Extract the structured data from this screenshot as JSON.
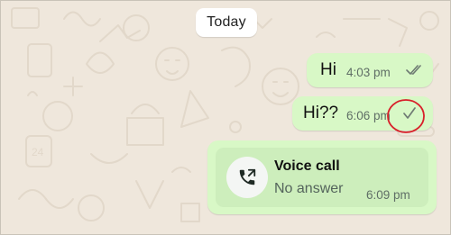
{
  "chat": {
    "date_chip": "Today",
    "messages": [
      {
        "text": "Hi",
        "time": "4:03 pm",
        "status": "read",
        "status_icon": "double-check-icon"
      },
      {
        "text": "Hi??",
        "time": "6:06 pm",
        "status": "sent",
        "status_icon": "single-check-icon"
      }
    ],
    "call": {
      "title": "Voice call",
      "status": "No answer",
      "time": "6:09 pm",
      "icon": "outgoing-call-icon"
    }
  },
  "colors": {
    "background": "#efe7dc",
    "outgoing_bubble": "#d8f8c6",
    "call_inner": "#cdeebc",
    "tick": "#6e7a73",
    "highlight": "#d8202a"
  }
}
